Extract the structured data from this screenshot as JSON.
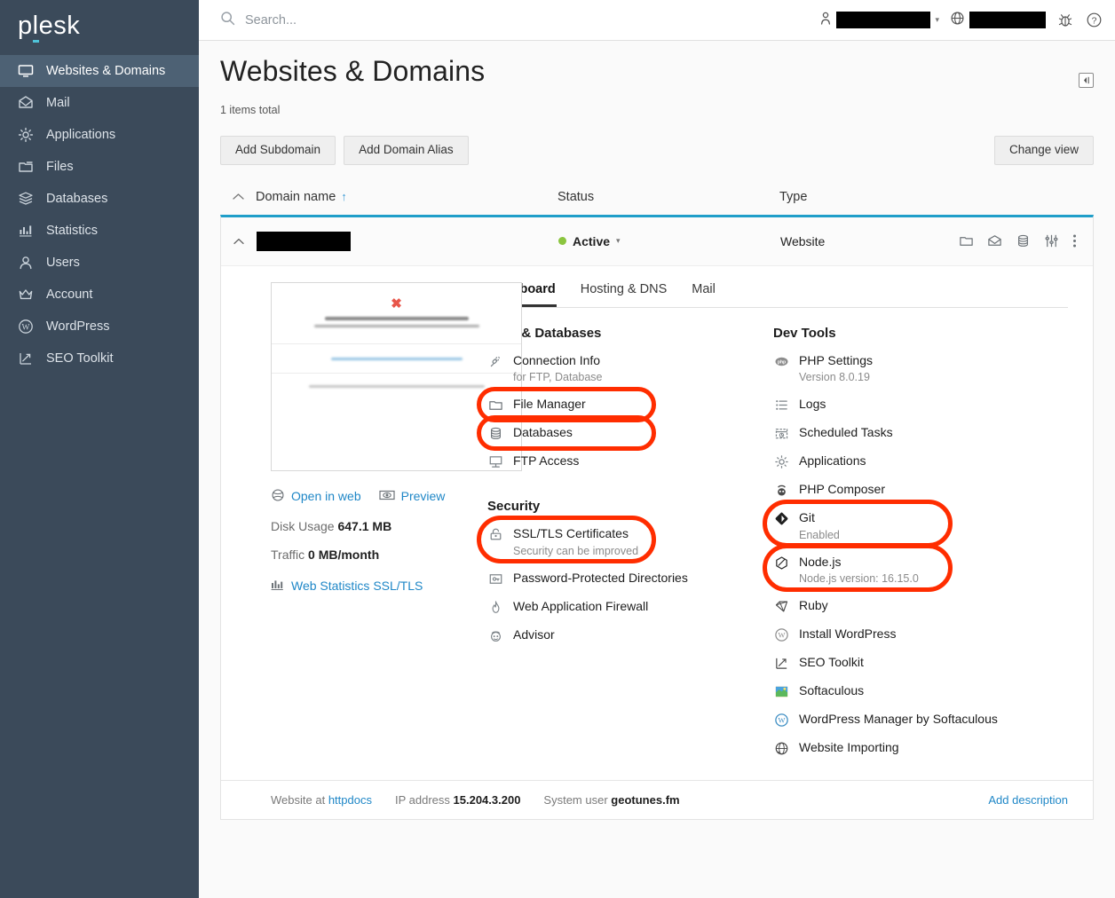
{
  "brand": {
    "name": "plesk",
    "accent": "#4fc3d9"
  },
  "sidebar": {
    "items": [
      {
        "label": "Websites & Domains",
        "icon": "monitor-icon",
        "active": true
      },
      {
        "label": "Mail",
        "icon": "envelope-icon",
        "active": false
      },
      {
        "label": "Applications",
        "icon": "gear-icon",
        "active": false
      },
      {
        "label": "Files",
        "icon": "folder-icon",
        "active": false
      },
      {
        "label": "Databases",
        "icon": "database-icon",
        "active": false
      },
      {
        "label": "Statistics",
        "icon": "bar-chart-icon",
        "active": false
      },
      {
        "label": "Users",
        "icon": "user-icon",
        "active": false
      },
      {
        "label": "Account",
        "icon": "crown-icon",
        "active": false
      },
      {
        "label": "WordPress",
        "icon": "wordpress-icon",
        "active": false
      },
      {
        "label": "SEO Toolkit",
        "icon": "seo-arrow-icon",
        "active": false
      }
    ]
  },
  "topbar": {
    "search_placeholder": "Search...",
    "search_value": "",
    "account_name": "",
    "locale_name": "",
    "icons": [
      "user-icon",
      "globe-icon",
      "bug-icon",
      "help-icon"
    ]
  },
  "page": {
    "title": "Websites & Domains",
    "items_total": "1 items total",
    "collapse_icon": "panel-collapse-icon"
  },
  "toolbar": {
    "add_subdomain": "Add Subdomain",
    "add_domain_alias": "Add Domain Alias",
    "change_view": "Change view"
  },
  "list_headers": {
    "domain_name": "Domain name",
    "sort_arrow": "↑",
    "status": "Status",
    "type": "Type"
  },
  "domain": {
    "name": "",
    "status": "Active",
    "status_color": "#8bc53f",
    "type": "Website",
    "row_icons": [
      "folder-icon",
      "envelope-icon",
      "database-icon",
      "sliders-icon",
      "kebab-menu-icon"
    ]
  },
  "preview": {
    "thumbnail_heading": "We're sorry, but something went wrong.",
    "thumbnail_sub": "The issue has been logged for investigation. Please try again later.",
    "thumbnail_link": "Send a note to the administrator of this website",
    "thumbnail_footer": "This website is powered by Plesk Obsidian. Let us know if you have some questions about Plesk.",
    "open_in_web": "Open in web",
    "preview": "Preview",
    "disk_usage_label": "Disk Usage",
    "disk_usage_value": "647.1 MB",
    "traffic_label": "Traffic",
    "traffic_value": "0 MB/month",
    "web_statistics": "Web Statistics SSL/TLS"
  },
  "tabs": [
    {
      "label": "Dashboard",
      "active": true
    },
    {
      "label": "Hosting & DNS",
      "active": false
    },
    {
      "label": "Mail",
      "active": false
    }
  ],
  "sections": {
    "files_databases": {
      "title": "Files & Databases",
      "tools": [
        {
          "label": "Connection Info",
          "sub": "for FTP, Database",
          "icon": "connection-icon",
          "highlighted": false
        },
        {
          "label": "File Manager",
          "sub": "",
          "icon": "folder-icon",
          "highlighted": true
        },
        {
          "label": "Databases",
          "sub": "",
          "icon": "database-icon",
          "highlighted": true
        },
        {
          "label": "FTP Access",
          "sub": "",
          "icon": "ftp-icon",
          "highlighted": false
        }
      ]
    },
    "security": {
      "title": "Security",
      "tools": [
        {
          "label": "SSL/TLS Certificates",
          "sub": "Security can be improved",
          "icon": "lock-icon",
          "highlighted": true
        },
        {
          "label": "Password-Protected Directories",
          "sub": "",
          "icon": "key-folder-icon",
          "highlighted": false
        },
        {
          "label": "Web Application Firewall",
          "sub": "",
          "icon": "flame-icon",
          "highlighted": false
        },
        {
          "label": "Advisor",
          "sub": "",
          "icon": "advisor-icon",
          "highlighted": false
        }
      ]
    },
    "dev_tools": {
      "title": "Dev Tools",
      "tools": [
        {
          "label": "PHP Settings",
          "sub": "Version 8.0.19",
          "icon": "php-icon",
          "highlighted": false
        },
        {
          "label": "Logs",
          "sub": "",
          "icon": "list-icon",
          "highlighted": false
        },
        {
          "label": "Scheduled Tasks",
          "sub": "",
          "icon": "calendar-clock-icon",
          "highlighted": false
        },
        {
          "label": "Applications",
          "sub": "",
          "icon": "gear-icon",
          "highlighted": false
        },
        {
          "label": "PHP Composer",
          "sub": "",
          "icon": "composer-icon",
          "highlighted": false
        },
        {
          "label": "Git",
          "sub": "Enabled",
          "icon": "git-icon",
          "highlighted": true
        },
        {
          "label": "Node.js",
          "sub": "Node.js version: 16.15.0",
          "icon": "nodejs-icon",
          "highlighted": true
        },
        {
          "label": "Ruby",
          "sub": "",
          "icon": "ruby-icon",
          "highlighted": false
        },
        {
          "label": "Install WordPress",
          "sub": "",
          "icon": "wordpress-icon",
          "highlighted": false
        },
        {
          "label": "SEO Toolkit",
          "sub": "",
          "icon": "seo-arrow-icon",
          "highlighted": false
        },
        {
          "label": "Softaculous",
          "sub": "",
          "icon": "softaculous-icon",
          "highlighted": false
        },
        {
          "label": "WordPress Manager by Softaculous",
          "sub": "",
          "icon": "wordpress-blue-icon",
          "highlighted": false
        },
        {
          "label": "Website Importing",
          "sub": "",
          "icon": "website-import-icon",
          "highlighted": false
        }
      ]
    }
  },
  "footer": {
    "website_at_label": "Website at",
    "website_at_value": "httpdocs",
    "ip_label": "IP address",
    "ip_value": "15.204.3.200",
    "system_user_label": "System user",
    "system_user_value": "geotunes.fm",
    "add_description": "Add description"
  }
}
